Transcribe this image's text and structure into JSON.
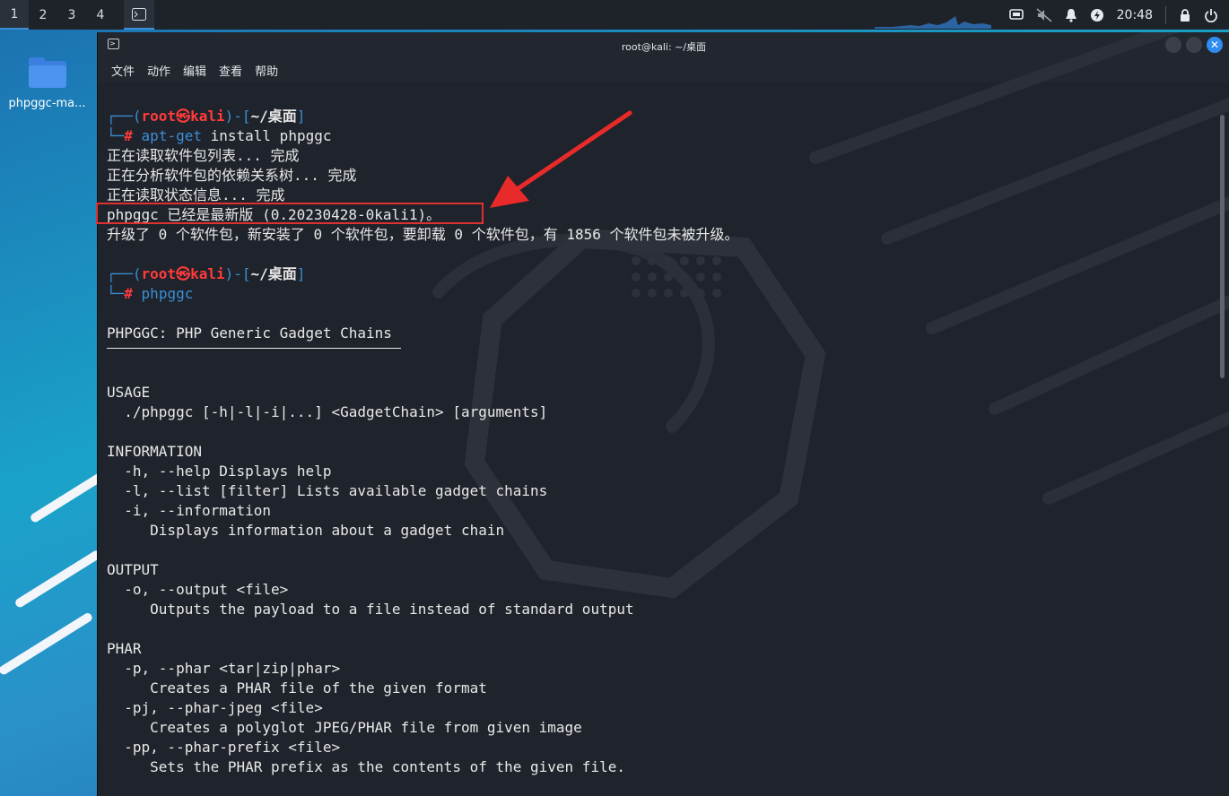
{
  "taskbar": {
    "workspaces": [
      "1",
      "2",
      "3",
      "4"
    ],
    "clock": "20:48"
  },
  "desktop": {
    "icon_label": "phpggc-ma..."
  },
  "window": {
    "title": "root@kali: ~/桌面",
    "menu": [
      "文件",
      "动作",
      "编辑",
      "查看",
      "帮助"
    ]
  },
  "terminal": {
    "prompt1": {
      "top_open": "┌──(",
      "user": "root㉿kali",
      "mid": ")-[",
      "dir": "~/桌面",
      "close": "]",
      "bottom": "└─",
      "hash": "#",
      "cmd_a": "apt-get",
      "cmd_b": " install phpggc"
    },
    "apt_output": [
      "正在读取软件包列表... 完成",
      "正在分析软件包的依赖关系树... 完成",
      "正在读取状态信息... 完成",
      "phpggc 已经是最新版 (0.20230428-0kali1)。",
      "升级了 0 个软件包，新安装了 0 个软件包，要卸载 0 个软件包，有 1856 个软件包未被升级。"
    ],
    "prompt2": {
      "top_open": "┌──(",
      "user": "root㉿kali",
      "mid": ")-[",
      "dir": "~/桌面",
      "close": "]",
      "bottom": "└─",
      "hash": "#",
      "cmd": "phpggc"
    },
    "help_lines": [
      "PHPGGC: PHP Generic Gadget Chains",
      "",
      "",
      "USAGE",
      "  ./phpggc [-h|-l|-i|...] <GadgetChain> [arguments]",
      "",
      "INFORMATION",
      "  -h, --help Displays help",
      "  -l, --list [filter] Lists available gadget chains",
      "  -i, --information",
      "     Displays information about a gadget chain",
      "",
      "OUTPUT",
      "  -o, --output <file>",
      "     Outputs the payload to a file instead of standard output",
      "",
      "PHAR",
      "  -p, --phar <tar|zip|phar>",
      "     Creates a PHAR file of the given format",
      "  -pj, --phar-jpeg <file>",
      "     Creates a polyglot JPEG/PHAR file from given image",
      "  -pp, --phar-prefix <file>",
      "     Sets the PHAR prefix as the contents of the given file."
    ]
  },
  "colors": {
    "prompt_blue": "#3b8fd6",
    "prompt_red": "#ff3b3b",
    "highlight_red": "#e03030",
    "terminal_bg": "#1f232b"
  }
}
